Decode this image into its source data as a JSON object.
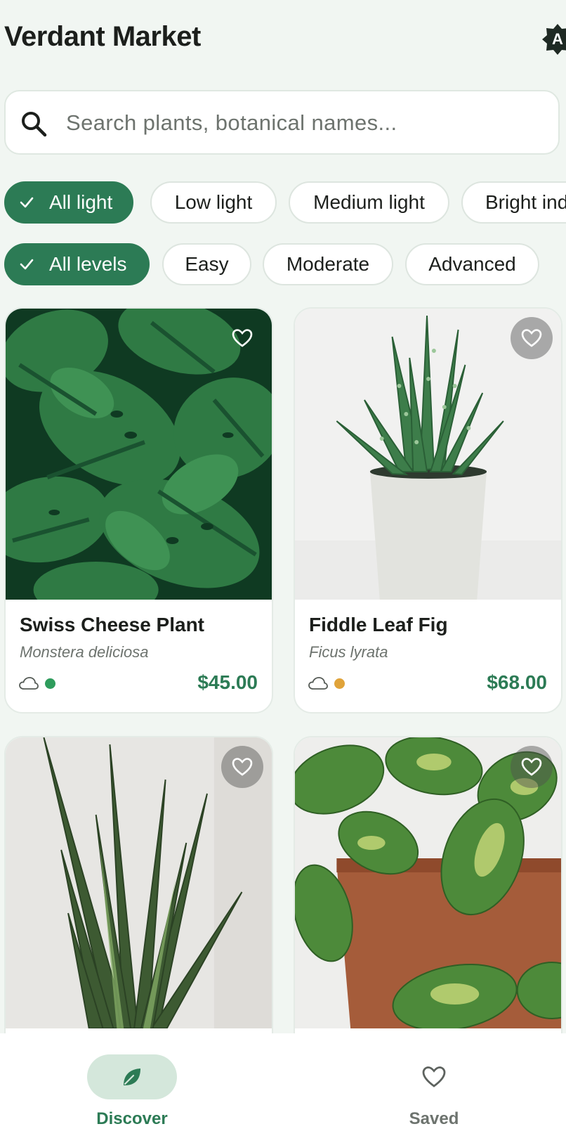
{
  "header": {
    "title": "Verdant Market",
    "badge": "A"
  },
  "search": {
    "placeholder": "Search plants, botanical names...",
    "value": ""
  },
  "light_filters": [
    {
      "label": "All light",
      "selected": true
    },
    {
      "label": "Low light",
      "selected": false
    },
    {
      "label": "Medium light",
      "selected": false
    },
    {
      "label": "Bright ind",
      "selected": false
    }
  ],
  "level_filters": [
    {
      "label": "All levels",
      "selected": true
    },
    {
      "label": "Easy",
      "selected": false
    },
    {
      "label": "Moderate",
      "selected": false
    },
    {
      "label": "Advanced",
      "selected": false
    }
  ],
  "products": [
    {
      "name": "Swiss Cheese Plant",
      "latin": "Monstera deliciosa",
      "price": "$45.00",
      "difficulty_color": "#2e9c5c",
      "light_icon": "cloud-icon",
      "image": "monstera-leaves"
    },
    {
      "name": "Fiddle Leaf Fig",
      "latin": "Ficus lyrata",
      "price": "$68.00",
      "difficulty_color": "#e0a33a",
      "light_icon": "cloud-icon",
      "image": "aloe-in-white-pot"
    },
    {
      "name": "",
      "latin": "",
      "price": "",
      "image": "snake-plant"
    },
    {
      "name": "",
      "latin": "",
      "price": "",
      "image": "pothos-in-terracotta-pot"
    }
  ],
  "nav": {
    "items": [
      {
        "label": "Discover",
        "icon": "leaf-icon",
        "active": true
      },
      {
        "label": "Saved",
        "icon": "heart-icon",
        "active": false
      }
    ]
  },
  "colors": {
    "accent": "#2c7b55",
    "background": "#f1f6f2",
    "active_pill": "#d4e7db"
  }
}
